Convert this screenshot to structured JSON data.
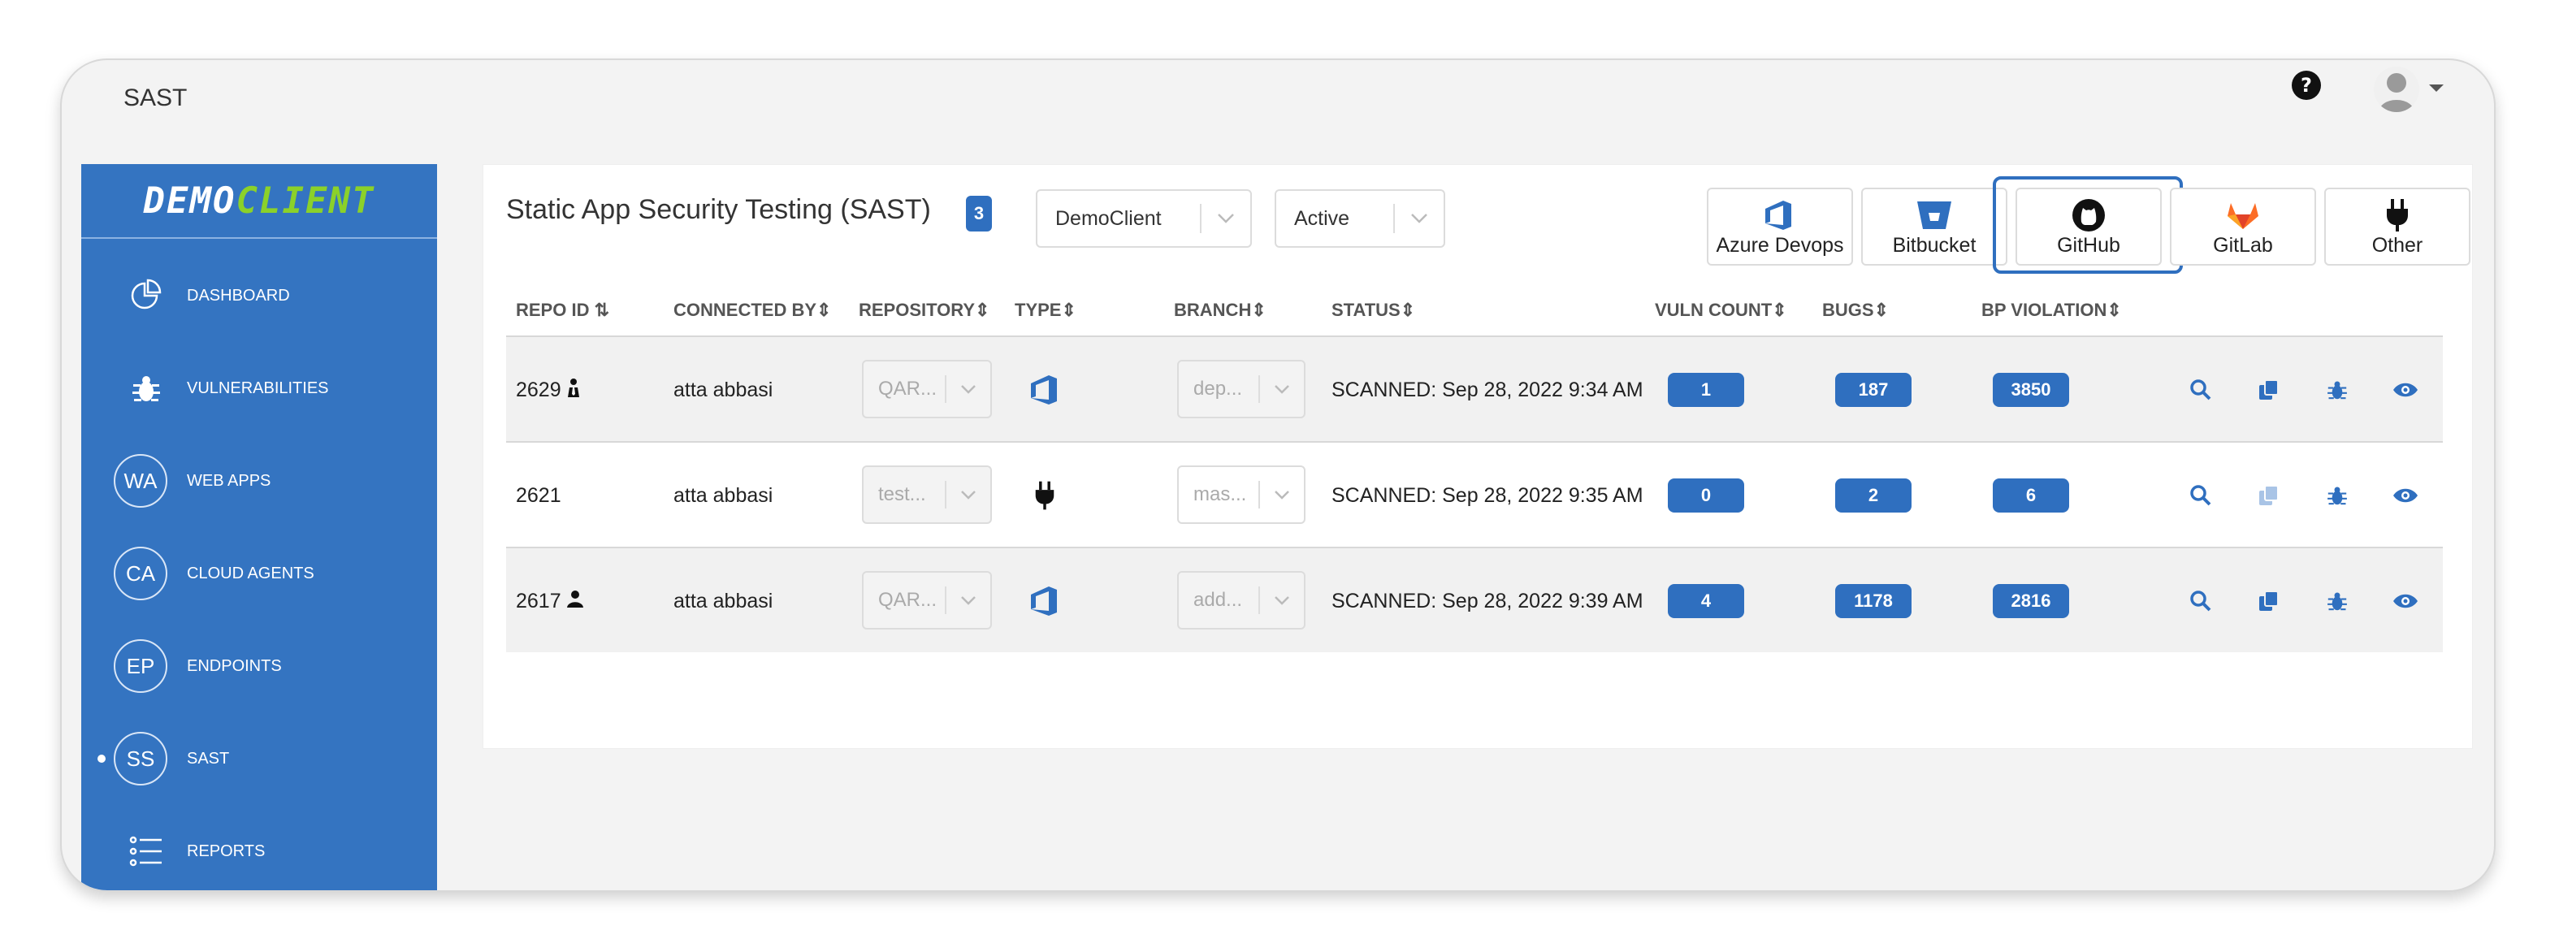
{
  "app": {
    "title": "SAST"
  },
  "sidebar": {
    "logo": {
      "part1": "DEMO",
      "part2": "CLIENT"
    },
    "items": [
      {
        "label": "DASHBOARD",
        "icon": "pie-chart-icon"
      },
      {
        "label": "VULNERABILITIES",
        "icon": "bug-icon"
      },
      {
        "label": "WEB APPS",
        "abbr": "WA"
      },
      {
        "label": "CLOUD AGENTS",
        "abbr": "CA"
      },
      {
        "label": "ENDPOINTS",
        "abbr": "EP"
      },
      {
        "label": "SAST",
        "abbr": "SS",
        "active": true
      },
      {
        "label": "REPORTS",
        "icon": "list-icon"
      }
    ]
  },
  "main": {
    "title": "Static App Security Testing (SAST)",
    "count": "3",
    "client_select": "DemoClient",
    "status_select": "Active",
    "integrations": [
      {
        "label": "Azure Devops",
        "icon": "azure-devops-icon"
      },
      {
        "label": "Bitbucket",
        "icon": "bitbucket-icon"
      },
      {
        "label": "GitHub",
        "icon": "github-icon",
        "focused": true
      },
      {
        "label": "GitLab",
        "icon": "gitlab-icon"
      },
      {
        "label": "Other",
        "icon": "plug-icon"
      }
    ],
    "columns": [
      "REPO ID",
      "CONNECTED BY",
      "REPOSITORY",
      "TYPE",
      "BRANCH",
      "STATUS",
      "VULN COUNT",
      "BUGS",
      "BP VIOLATION"
    ],
    "rows": [
      {
        "repo_id": "2629",
        "owner_icon": "user-tie-icon",
        "connected_by": "atta abbasi",
        "repository": "QAR...",
        "type_icon": "azure-devops-icon",
        "branch": "dep...",
        "status": "SCANNED: Sep 28, 2022 9:34 AM",
        "vuln_count": "1",
        "bugs": "187",
        "bp_violation": "3850"
      },
      {
        "repo_id": "2621",
        "owner_icon": "",
        "connected_by": "atta abbasi",
        "repository": "test...",
        "type_icon": "plug-icon",
        "branch": "mas...",
        "status": "SCANNED: Sep 28, 2022 9:35 AM",
        "vuln_count": "0",
        "bugs": "2",
        "bp_violation": "6"
      },
      {
        "repo_id": "2617",
        "owner_icon": "user-icon",
        "connected_by": "atta abbasi",
        "repository": "QAR...",
        "type_icon": "azure-devops-icon",
        "branch": "add...",
        "status": "SCANNED: Sep 28, 2022 9:39 AM",
        "vuln_count": "4",
        "bugs": "1178",
        "bp_violation": "2816"
      }
    ]
  },
  "colors": {
    "primary": "#3474c1",
    "accent_green": "#8bd12a",
    "badge": "#2f6fbf"
  }
}
